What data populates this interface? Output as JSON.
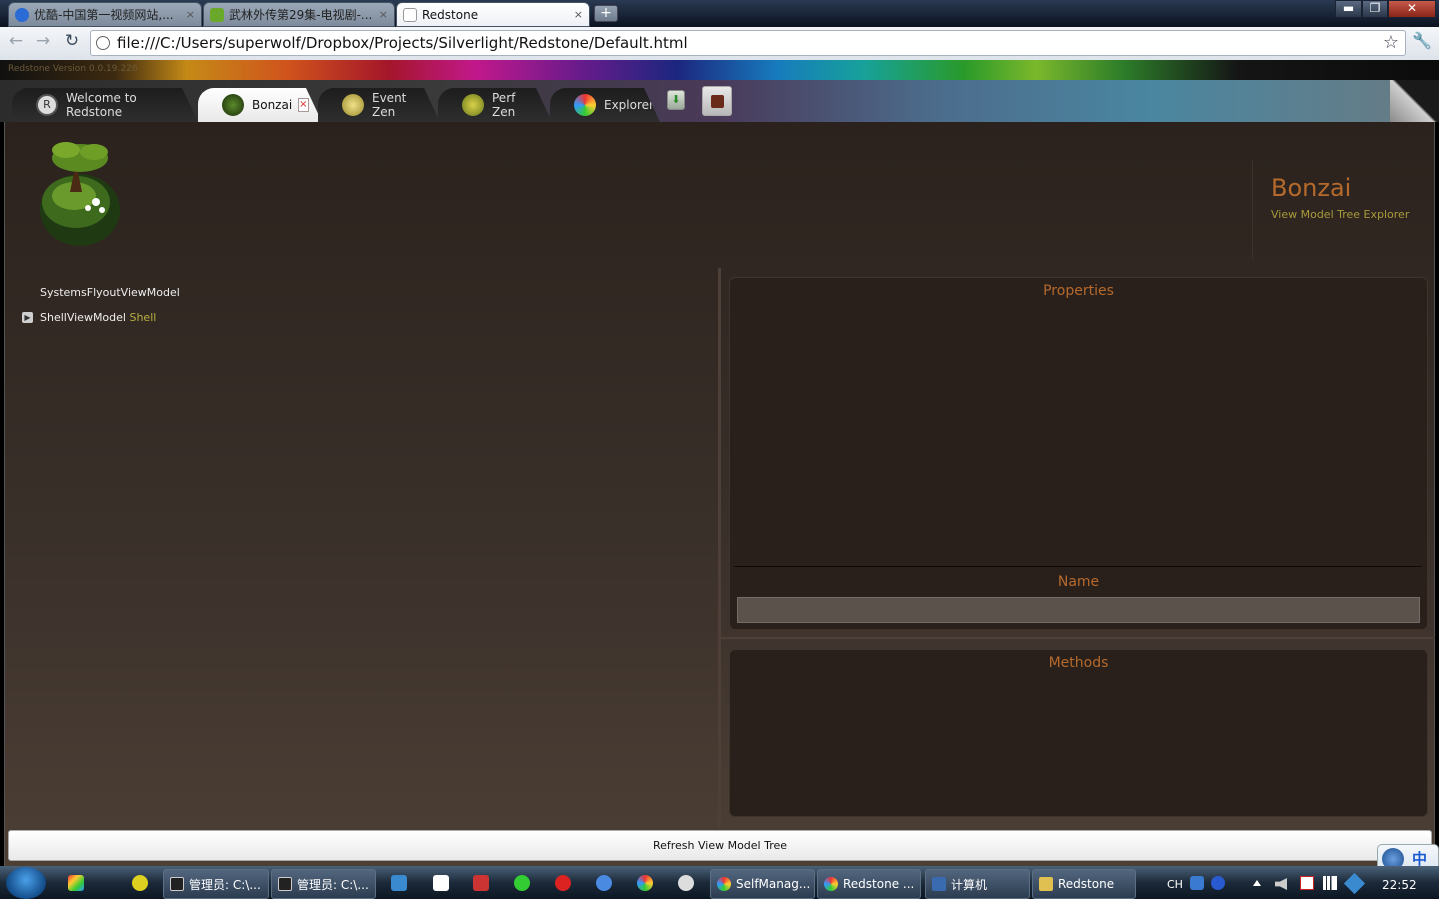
{
  "browser": {
    "tabs": [
      {
        "label": "优酷-中国第一视频网站,...",
        "close": "×"
      },
      {
        "label": "武林外传第29集-电视剧-...",
        "close": "×"
      },
      {
        "label": "Redstone",
        "close": "×"
      }
    ],
    "new_tab": "+",
    "window_controls": {
      "minimize": "▬",
      "maximize": "❐",
      "close": "✕"
    },
    "nav": {
      "back": "←",
      "forward": "→",
      "reload": "↻"
    },
    "url": "file:///C:/Users/superwolf/Dropbox/Projects/Silverlight/Redstone/Default.html",
    "star_icon": "☆",
    "wrench_icon": "🔧"
  },
  "app": {
    "version": "Redstone Version 0.0.19.226",
    "tabs": [
      {
        "label": "Welcome to Redstone",
        "icon": "redstone-logo-icon",
        "icon_letter": "R"
      },
      {
        "label": "Bonzai",
        "icon": "bonzai-tree-icon",
        "close": "×"
      },
      {
        "label": "Event Zen",
        "icon": "event-zen-icon"
      },
      {
        "label": "Perf Zen",
        "icon": "perf-zen-icon"
      },
      {
        "label": "Explorer",
        "icon": "explorer-icon"
      }
    ],
    "download_icon": "⬇",
    "header": {
      "title": "Bonzai",
      "subtitle": "View Model Tree Explorer"
    },
    "tree": [
      {
        "name": "SystemsFlyoutViewModel",
        "tag": ""
      },
      {
        "name": "ShellViewModel",
        "tag": "Shell",
        "expander": "▶"
      }
    ],
    "properties": {
      "title": "Properties",
      "name_label": "Name",
      "name_value": ""
    },
    "methods": {
      "title": "Methods"
    },
    "refresh_label": "Refresh View Model Tree",
    "colors": {
      "accent": "#b56a2c",
      "subtitle": "#a89a3a",
      "tag": "#b8b040"
    }
  },
  "ime": {
    "label": "中"
  },
  "taskbar": {
    "items": [
      {
        "label": "管理员: C:\\..."
      },
      {
        "label": "管理员: C:\\..."
      },
      {
        "label": "SelfManag..."
      },
      {
        "label": "Redstone ..."
      },
      {
        "label": "计算机"
      },
      {
        "label": "Redstone"
      }
    ],
    "tray": {
      "lang": "CH"
    },
    "clock": "22:52"
  }
}
